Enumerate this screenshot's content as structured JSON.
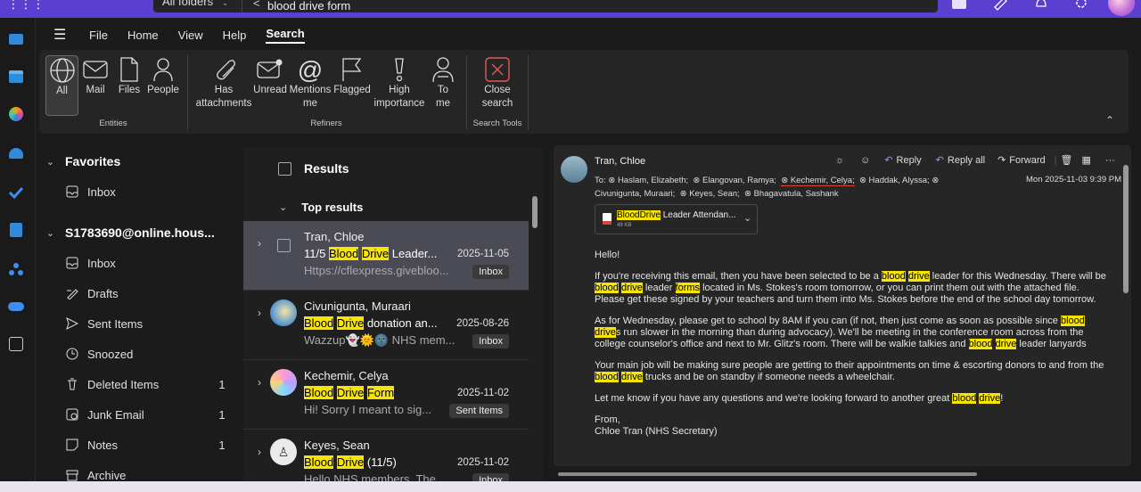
{
  "search": {
    "scope": "All folders",
    "query": "blood drive form"
  },
  "ribbon_tabs": [
    "File",
    "Home",
    "View",
    "Help",
    "Search"
  ],
  "ribbon": {
    "entities": {
      "all": "All",
      "mail": "Mail",
      "files": "Files",
      "people": "People",
      "group": "Entities"
    },
    "refiners": {
      "attach1": "Has",
      "attach2": "attachments",
      "unread": "Unread",
      "mentions1": "Mentions",
      "mentions2": "me",
      "flagged": "Flagged",
      "high1": "High",
      "high2": "importance",
      "tome1": "To",
      "tome2": "me",
      "group": "Refiners"
    },
    "tools": {
      "close1": "Close",
      "close2": "search",
      "group": "Search Tools"
    }
  },
  "folders": {
    "favorites": "Favorites",
    "fav_inbox": "Inbox",
    "account": "S1783690@online.hous...",
    "items": [
      {
        "label": "Inbox",
        "count": ""
      },
      {
        "label": "Drafts",
        "count": ""
      },
      {
        "label": "Sent Items",
        "count": ""
      },
      {
        "label": "Snoozed",
        "count": ""
      },
      {
        "label": "Deleted Items",
        "count": "1"
      },
      {
        "label": "Junk Email",
        "count": "1"
      },
      {
        "label": "Notes",
        "count": "1"
      },
      {
        "label": "Archive",
        "count": ""
      }
    ]
  },
  "list": {
    "header": "Results",
    "top": "Top results",
    "messages": [
      {
        "sender": "Tran, Chloe",
        "subj_pre": "11/5 ",
        "w1": "Blood",
        "w2": "Drive",
        "subj_post": " Leader...",
        "date": "2025-11-05",
        "preview": "Https://cflexpress.givebloo...",
        "badge": "Inbox"
      },
      {
        "sender": "Civunigunta, Muraari",
        "subj_pre": "",
        "w1": "Blood",
        "w2": "Drive",
        "subj_post": " donation an...",
        "date": "2025-08-26",
        "preview": "Wazzup👻🌞🌚 NHS mem...",
        "badge": "Inbox"
      },
      {
        "sender": "Kechemir, Celya",
        "subj_pre": "",
        "w1": "Blood",
        "w2": "Drive",
        "w3": "Form",
        "subj_post": "",
        "date": "2025-11-02",
        "preview": "Hi! Sorry I meant to sig...",
        "badge": "Sent Items"
      },
      {
        "sender": "Keyes, Sean",
        "subj_pre": "",
        "w1": "Blood",
        "w2": "Drive",
        "subj_post": " (11/5)",
        "date": "2025-11-02",
        "preview": "Hello NHS members, The ",
        "badge": "Inbox"
      }
    ]
  },
  "reader": {
    "from": "Tran, Chloe",
    "to_label": "To:",
    "recipients": [
      "Haslam, Elizabeth;",
      "Elangovan, Ramya;",
      "Kechemir, Celya;",
      "Haddak, Alyssa;",
      "Civunigunta, Muraari;",
      "Keyes, Sean;",
      "Bhagavatula, Sashank"
    ],
    "date": "Mon 2025-11-03 9:39 PM",
    "actions": {
      "reply": "Reply",
      "replyall": "Reply all",
      "forward": "Forward"
    },
    "attachment": {
      "w1": "Blood",
      "w2": "Drive",
      "rest": " Leader Attendan...",
      "size": "49 KB"
    },
    "hl": {
      "blood": "blood",
      "drive": "drive",
      "forms": "forms",
      "drive_s": "drive"
    },
    "body": {
      "greeting": "Hello!",
      "p1a": "If you're receiving this email, then you have been selected to be a ",
      "p1b": " leader for this Wednesday. There will be ",
      "p1c": " leader ",
      "p1d": " located in Ms. Stokes's room tomorrow, or you can print them out with the attached file. Please get these signed by your teachers and turn them into Ms. Stokes before the end of the school day tomorrow.",
      "p2a": "As for Wednesday, please get to school by 8AM if you can (if not, then just come as soon as possible since ",
      "p2b": "s run slower in the morning than during advocacy). We'll be meeting in the conference room across from the college counselor's office and next to Mr. Glitz's room. There will be walkie talkies and ",
      "p2c": " leader lanyards",
      "p3a": "Your main job will be making sure people are getting to their appointments on time & escorting donors to and from the ",
      "p3b": " trucks and be on standby if someone needs a wheelchair.",
      "p4a": "Let me know if you have any questions and we're looking forward to another great ",
      "p4b": "!",
      "sig1": "From,",
      "sig2": "Chloe Tran (NHS Secretary)"
    }
  }
}
